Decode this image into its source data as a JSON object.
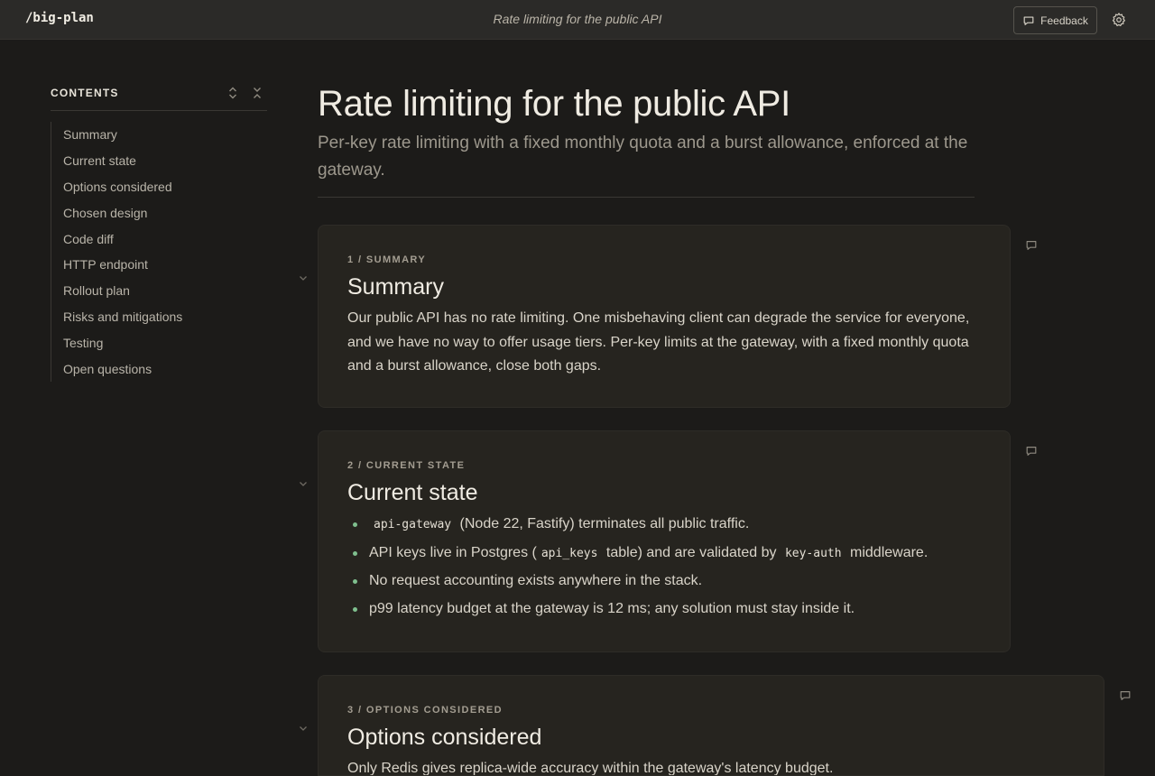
{
  "app": {
    "brand": "/big-plan",
    "document_title": "Rate limiting for the public API"
  },
  "header": {
    "feedback_label": "Feedback"
  },
  "toc": {
    "title": "CONTENTS",
    "items": [
      "Summary",
      "Current state",
      "Options considered",
      "Chosen design",
      "Code diff",
      "HTTP endpoint",
      "Rollout plan",
      "Risks and mitigations",
      "Testing",
      "Open questions"
    ]
  },
  "page": {
    "title": "Rate limiting for the public API",
    "subtitle": "Per-key rate limiting with a fixed monthly quota and a burst allowance, enforced at the gateway."
  },
  "sections": [
    {
      "label": "1 / SUMMARY",
      "title": "Summary",
      "body": "Our public API has no rate limiting. One misbehaving client can degrade the service for everyone, and we have no way to offer usage tiers. Per-key limits at the gateway, with a fixed monthly quota and a burst allowance, close both gaps."
    },
    {
      "label": "2 / CURRENT STATE",
      "title": "Current state",
      "bullets": [
        {
          "code1": "api-gateway",
          "text1": " (Node 22, Fastify) terminates all public traffic."
        },
        {
          "text1": "API keys live in Postgres (",
          "code1": "api_keys",
          "text2": " table) and are validated by ",
          "code2": "key-auth",
          "text3": " middleware."
        },
        {
          "text1": "No request accounting exists anywhere in the stack."
        },
        {
          "text1": "p99 latency budget at the gateway is 12 ms; any solution must stay inside it."
        }
      ]
    },
    {
      "label": "3 / OPTIONS CONSIDERED",
      "title": "Options considered",
      "body": "Only Redis gives replica-wide accuracy within the gateway's latency budget."
    }
  ],
  "colors": {
    "accent_bullet": "#7fbf8e",
    "background": "#1c1b19",
    "card": "#26241f"
  }
}
